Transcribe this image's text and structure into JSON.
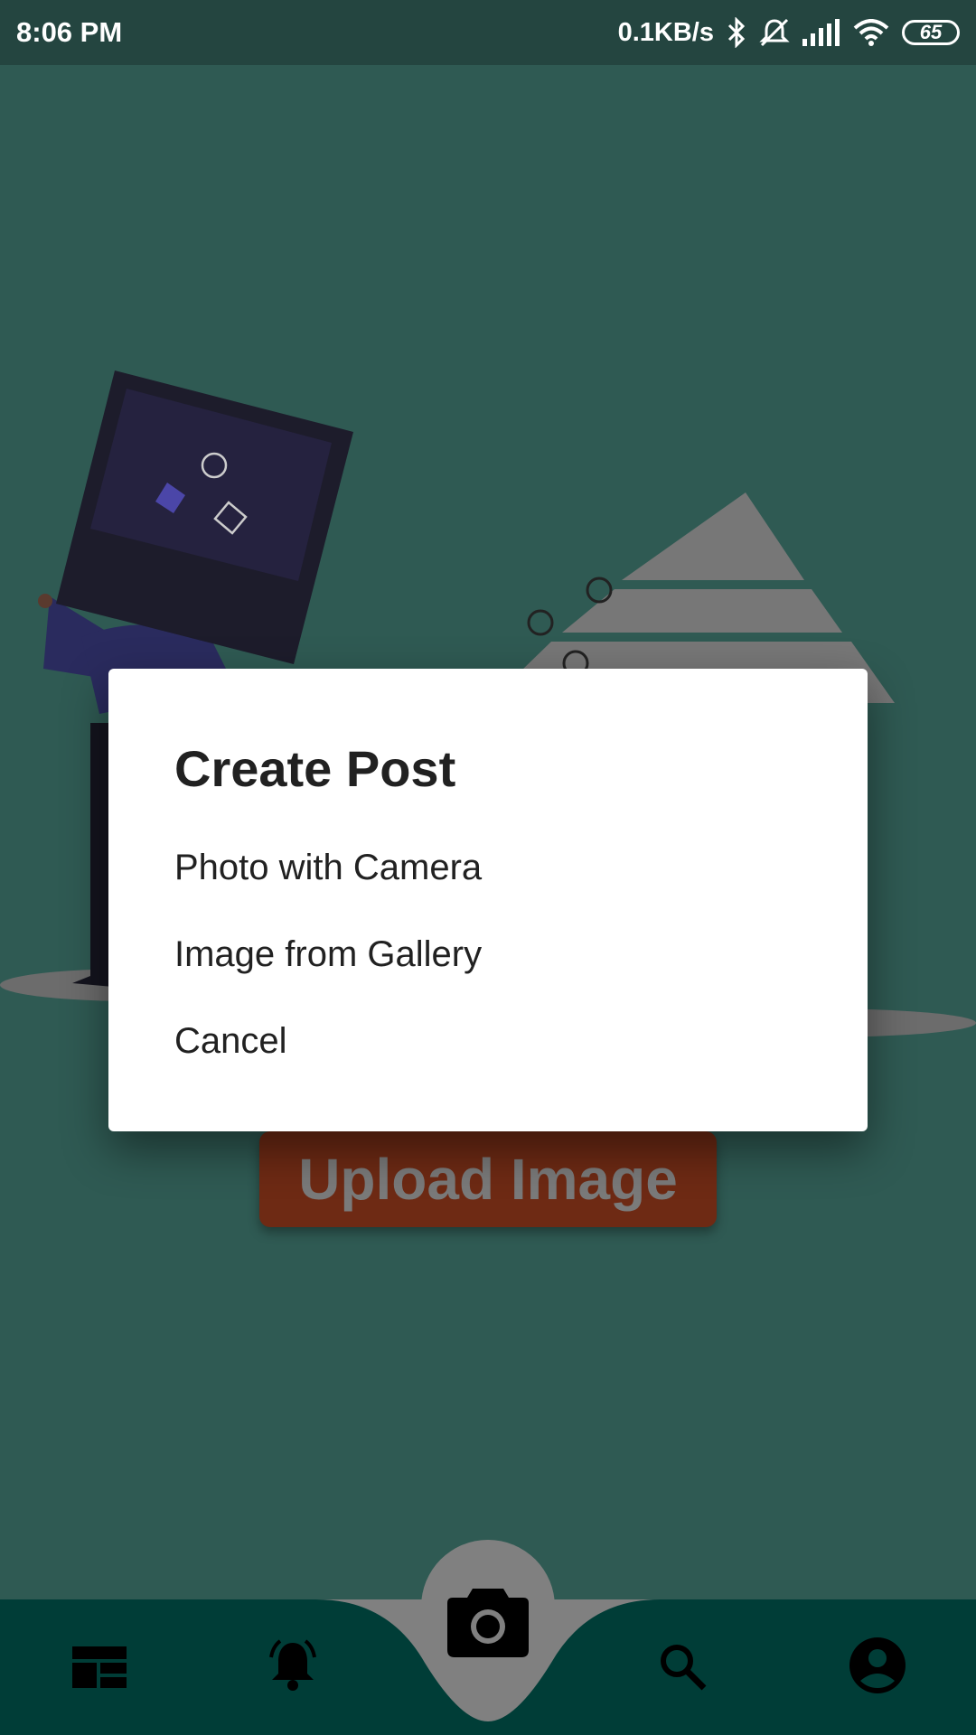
{
  "status_bar": {
    "time": "8:06 PM",
    "network_speed": "0.1KB/s",
    "battery_level": "65",
    "icons": [
      "bluetooth-icon",
      "silent-icon",
      "signal-icon",
      "wifi-icon",
      "battery-icon"
    ]
  },
  "main": {
    "upload_button_label": "Upload Image"
  },
  "dialog": {
    "title": "Create Post",
    "options": [
      {
        "label": "Photo with Camera"
      },
      {
        "label": "Image from Gallery"
      },
      {
        "label": "Cancel"
      }
    ]
  },
  "bottom_nav": {
    "items": [
      "timeline-icon",
      "notifications-icon",
      "camera-icon",
      "search-icon",
      "profile-icon"
    ]
  },
  "colors": {
    "background": "#2f5a53",
    "status_bar": "#244540",
    "nav_bar": "#003d37",
    "button": "#6e2a14"
  }
}
